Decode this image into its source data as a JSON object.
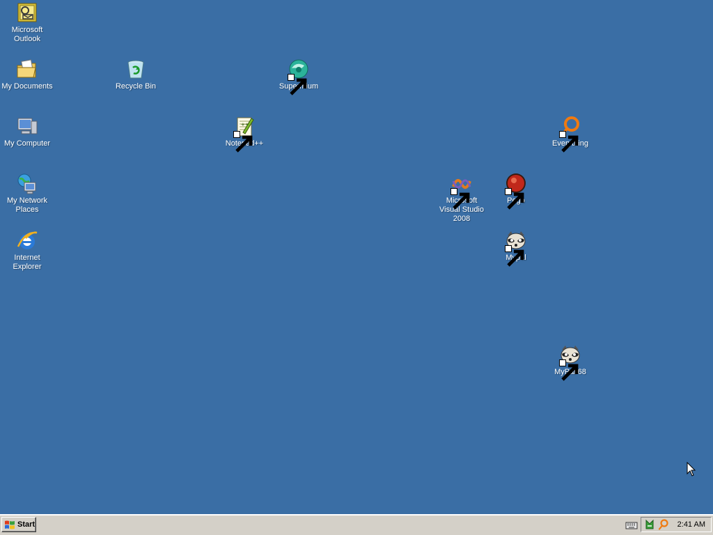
{
  "desktop": {
    "background_color": "#3a6ea5",
    "icons": {
      "outlook": {
        "label": "Microsoft Outlook",
        "icon": "outlook-icon"
      },
      "my_documents": {
        "label": "My Documents",
        "icon": "folder-documents-icon"
      },
      "recycle_bin": {
        "label": "Recycle Bin",
        "icon": "recycle-bin-icon"
      },
      "supermium": {
        "label": "Supermium",
        "icon": "supermium-icon",
        "shortcut": true
      },
      "my_computer": {
        "label": "My Computer",
        "icon": "computer-icon"
      },
      "notepadpp": {
        "label": "Notepad++",
        "icon": "notepadpp-icon",
        "shortcut": true
      },
      "everything": {
        "label": "Everything",
        "icon": "everything-search-icon",
        "shortcut": true
      },
      "network_places": {
        "label": "My Network Places",
        "icon": "network-places-icon"
      },
      "visual_studio": {
        "label": "Microsoft Visual Studio 2008",
        "icon": "visual-studio-icon",
        "shortcut": true
      },
      "pego": {
        "label": "Pego",
        "icon": "pego-icon",
        "shortcut": true
      },
      "internet_explorer": {
        "label": "Internet Explorer",
        "icon": "internet-explorer-icon"
      },
      "mypal": {
        "label": "Mypal",
        "icon": "mypal-raccoon-icon",
        "shortcut": true
      },
      "mypal68": {
        "label": "MyPal 68",
        "icon": "mypal-raccoon-icon",
        "shortcut": true
      }
    }
  },
  "taskbar": {
    "start_label": "Start",
    "tray": {
      "clock": "2:41 AM",
      "icons": [
        "keyboard-icon",
        "tray-app-icon",
        "everything-tray-icon"
      ]
    }
  }
}
